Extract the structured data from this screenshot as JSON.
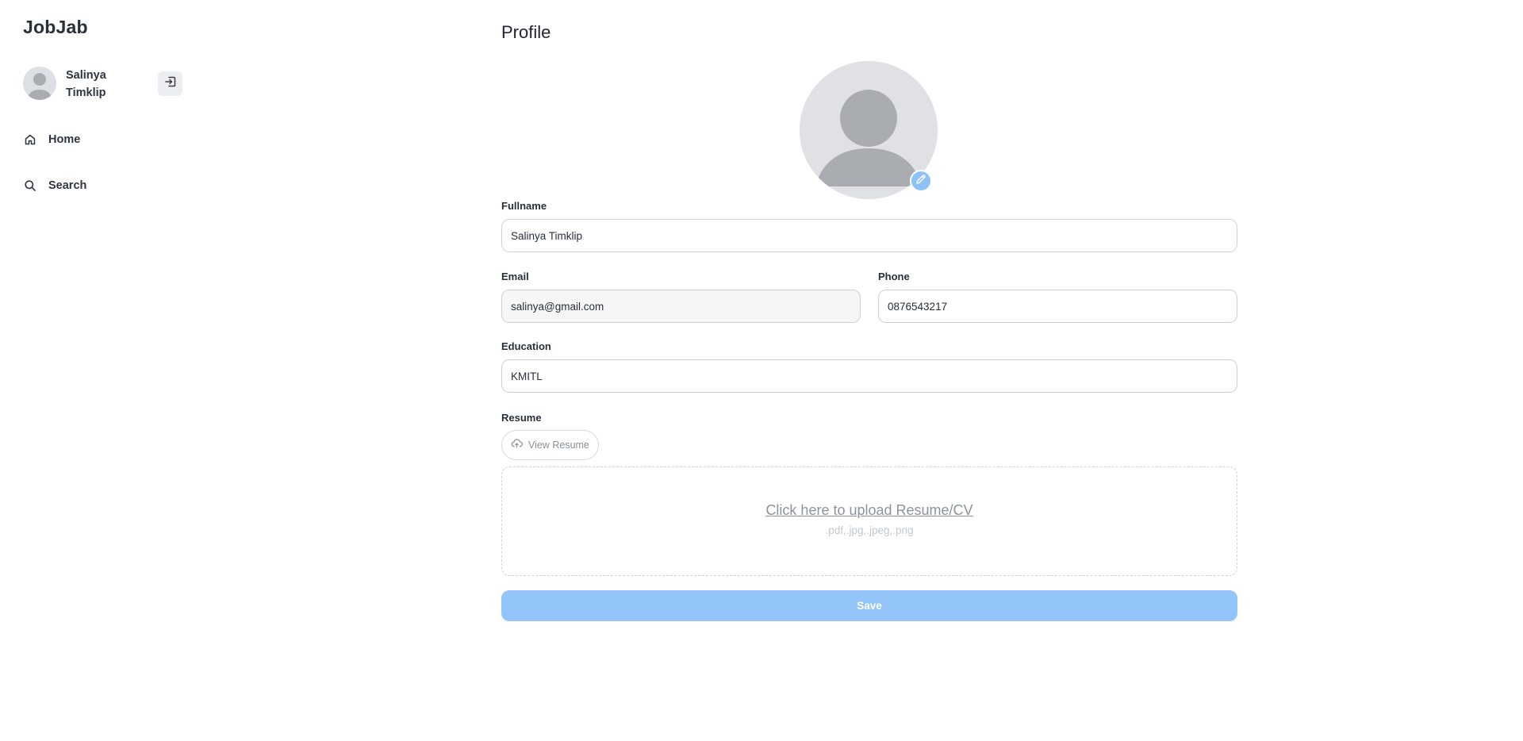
{
  "app": {
    "logo": "JobJab"
  },
  "sidebar": {
    "user": {
      "name": "Salinya Timklip",
      "avatar_icon": "default-avatar-icon"
    },
    "logout_icon": "logout-icon",
    "items": [
      {
        "label": "Home",
        "icon": "home-icon"
      },
      {
        "label": "Search",
        "icon": "search-icon"
      }
    ]
  },
  "profile": {
    "title": "Profile",
    "edit_photo_icon": "pencil-icon",
    "fields": {
      "fullname": {
        "label": "Fullname",
        "value": "Salinya Timklip"
      },
      "email": {
        "label": "Email",
        "value": "salinya@gmail.com"
      },
      "phone": {
        "label": "Phone",
        "value": "0876543217"
      },
      "education": {
        "label": "Education",
        "value": "KMITL"
      }
    },
    "resume": {
      "label": "Resume",
      "view_label": "View Resume",
      "view_icon": "cloud-icon",
      "upload_text": "Click here to upload Resume/CV",
      "upload_hint": ".pdf,.jpg,.jpeg,.png"
    },
    "save_label": "Save"
  },
  "colors": {
    "accent": "#93c5fb",
    "edit_badge": "#8ec2f7",
    "text": "#1f2430"
  }
}
